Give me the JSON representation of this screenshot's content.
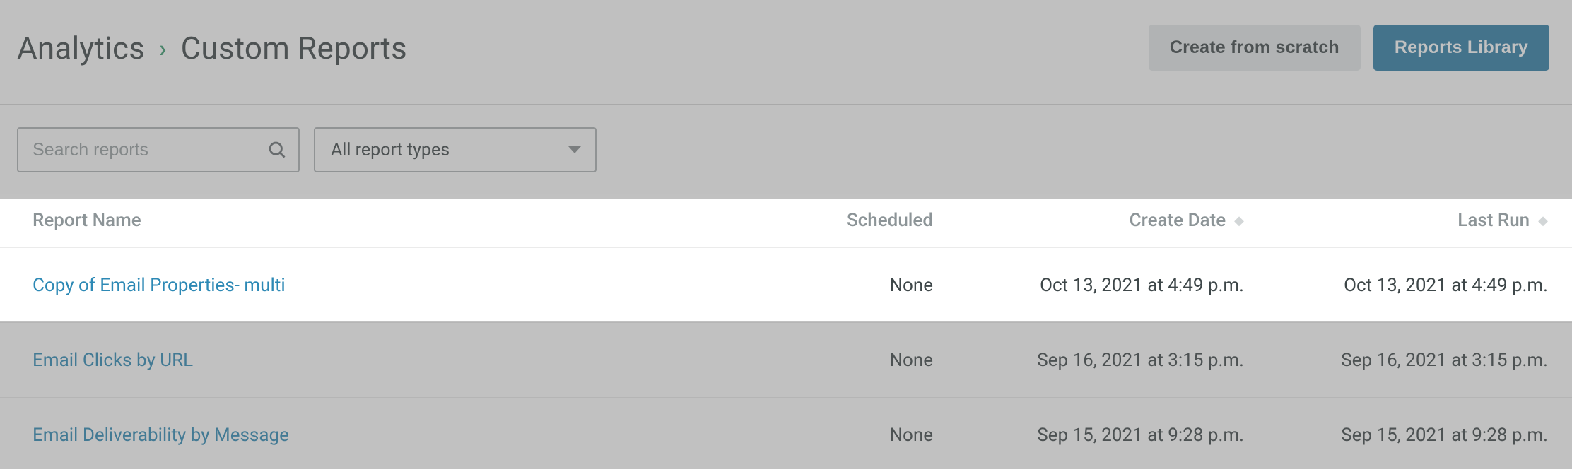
{
  "breadcrumb": {
    "root": "Analytics",
    "current": "Custom Reports"
  },
  "header": {
    "create_label": "Create from scratch",
    "library_label": "Reports Library"
  },
  "filters": {
    "search_placeholder": "Search reports",
    "type_select_label": "All report types"
  },
  "table": {
    "columns": {
      "name": "Report Name",
      "scheduled": "Scheduled",
      "create_date": "Create Date",
      "last_run": "Last Run"
    },
    "rows": [
      {
        "name": "Copy of Email Properties- multi",
        "scheduled": "None",
        "create_date": "Oct 13, 2021 at 4:49 p.m.",
        "last_run": "Oct 13, 2021 at 4:49 p.m."
      },
      {
        "name": "Email Clicks by URL",
        "scheduled": "None",
        "create_date": "Sep 16, 2021 at 3:15 p.m.",
        "last_run": "Sep 16, 2021 at 3:15 p.m."
      },
      {
        "name": "Email Deliverability by Message",
        "scheduled": "None",
        "create_date": "Sep 15, 2021 at 9:28 p.m.",
        "last_run": "Sep 15, 2021 at 9:28 p.m."
      }
    ]
  }
}
